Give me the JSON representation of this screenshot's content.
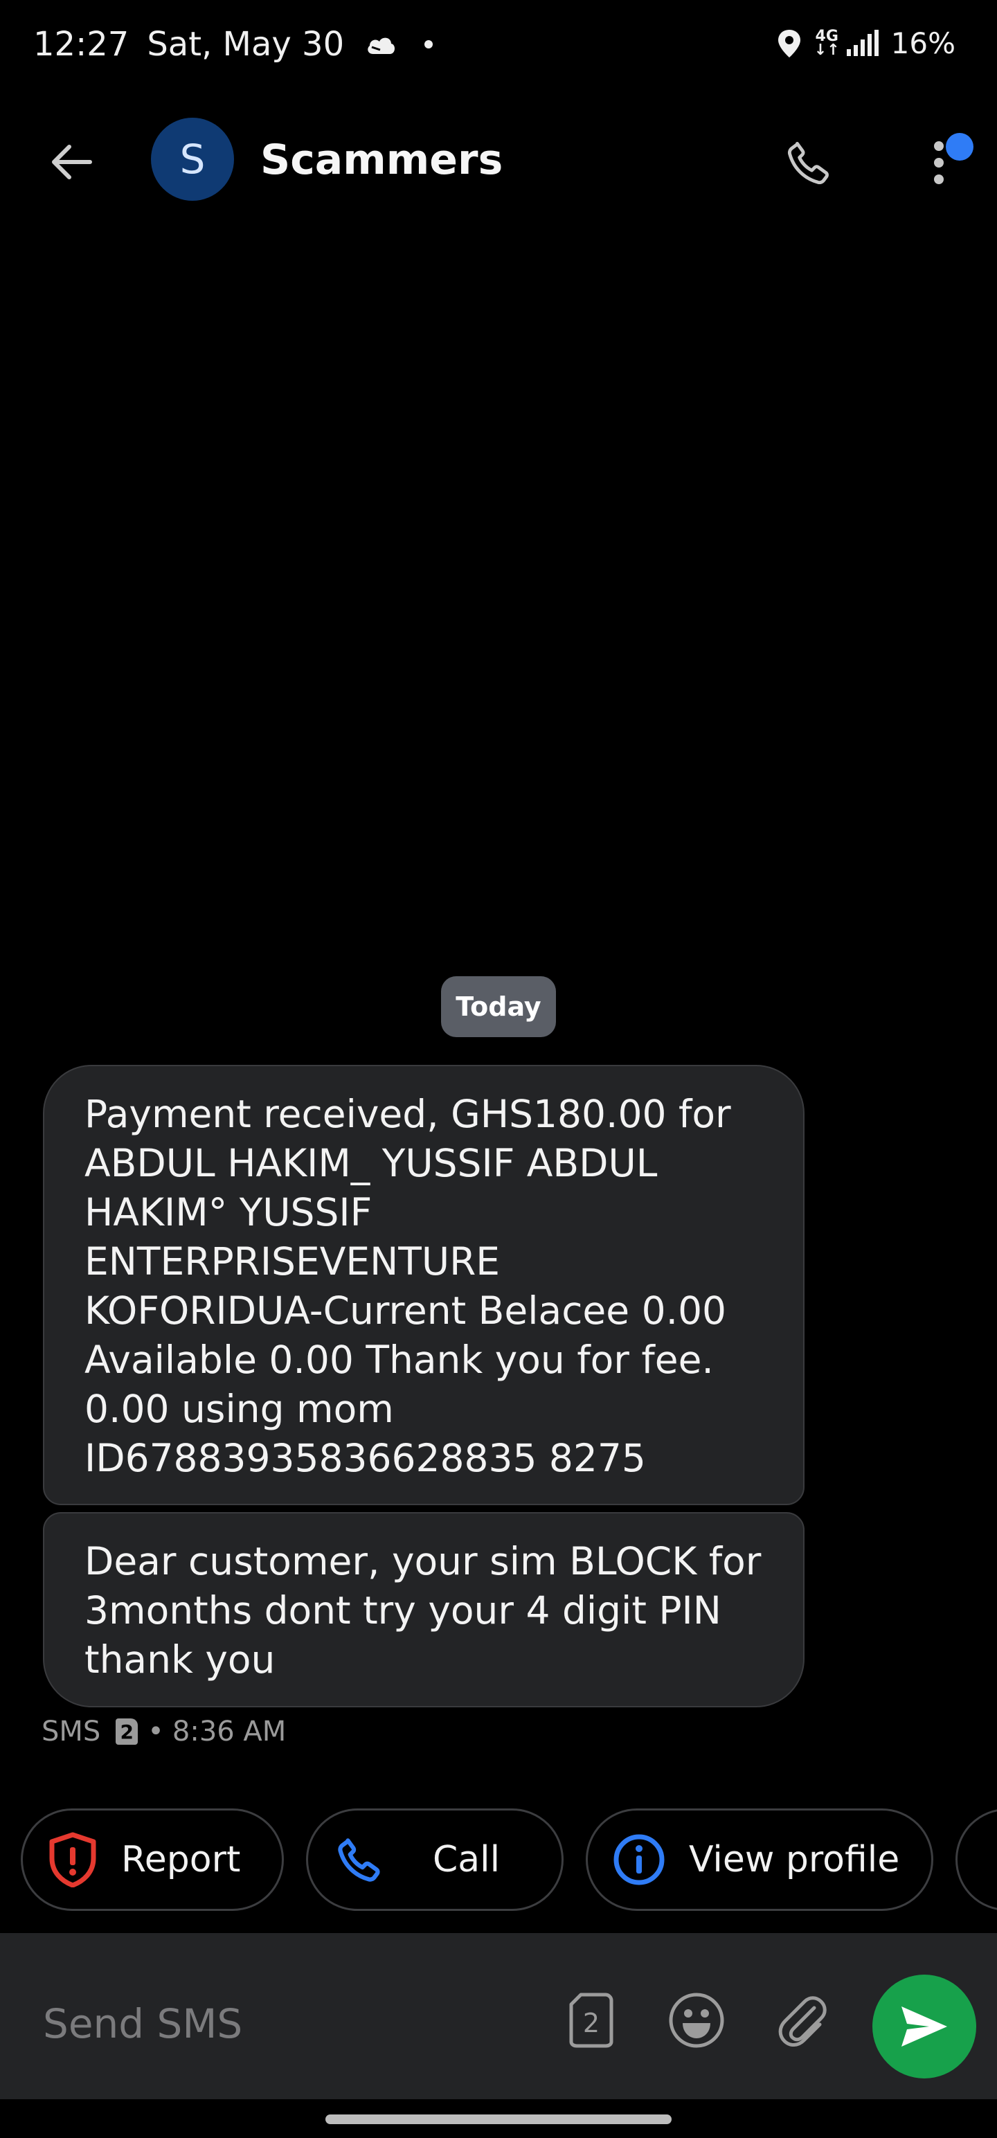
{
  "status_bar": {
    "time": "12:27",
    "date": "Sat, May 30",
    "network": "4G",
    "battery": "16%"
  },
  "header": {
    "avatar_letter": "S",
    "contact_name": "Scammers"
  },
  "conversation": {
    "date_divider": "Today",
    "messages": [
      {
        "text": "Payment received, GHS180.00 for\nABDUL HAKIM_ YUSSIF ABDUL\nHAKIM° YUSSIF\nENTERPRISEVENTURE\nKOFORIDUA-Current Belacee 0.00\nAvailable 0.00 Thank you for fee.\n0.00 using mom\nID67883935836628835 8275"
      },
      {
        "text": "Dear customer, your sim BLOCK for\n3months dont try your 4 digit PIN\nthank you"
      }
    ],
    "meta": {
      "type": "SMS",
      "sim_slot": "2",
      "separator": "•",
      "time": "8:36 AM"
    }
  },
  "suggestions": {
    "report_label": "Report",
    "call_label": "Call",
    "view_profile_label": "View profile"
  },
  "compose": {
    "placeholder": "Send SMS",
    "sim_slot": "2"
  },
  "colors": {
    "background": "#000000",
    "bubble": "#232426",
    "avatar": "#0f3a73",
    "send_button": "#17a14b",
    "report_icon": "#e5392f",
    "accent_blue": "#2f7cf6"
  }
}
